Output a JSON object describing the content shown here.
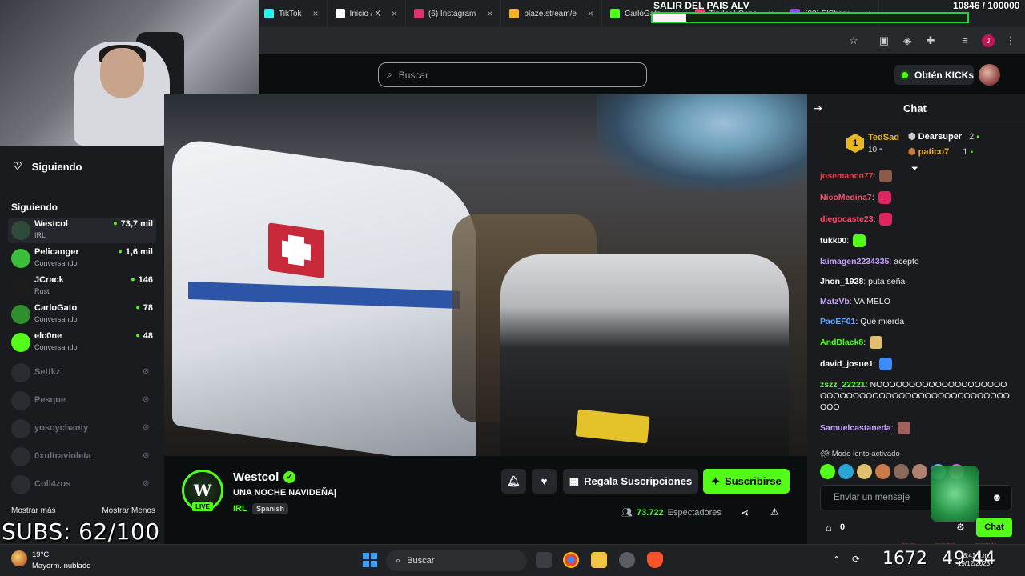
{
  "browser": {
    "tabs": [
      {
        "label": "TikTok",
        "color": "#25f4ee"
      },
      {
        "label": "Inicio / X",
        "color": "#ffffff"
      },
      {
        "label": "(6) Instagram",
        "color": "#e1306c"
      },
      {
        "label": "blaze.stream/e",
        "color": "#f0b429"
      },
      {
        "label": "CarloGato",
        "color": "#53fc18"
      },
      {
        "label": "Tinder | Conc",
        "color": "#fe3c72"
      },
      {
        "label": "(33) ElShark_",
        "color": "#9146ff"
      }
    ]
  },
  "stream_overlay": {
    "goal_label": "SALIR DEL PAIS ALV",
    "goal_count": "10846 / 100000",
    "goal_progress": 0.108,
    "subs_goal": "SUBS: 62/100"
  },
  "header": {
    "search_placeholder": "Buscar",
    "kicks_button": "Obtén KICKs"
  },
  "sidebar": {
    "title": "Siguiendo",
    "subtitle": "Siguiendo",
    "live_channels": [
      {
        "name": "Westcol",
        "category": "IRL",
        "viewers": "73,7 mil",
        "color": "#2e4a3a",
        "active": true
      },
      {
        "name": "Pelicanger",
        "category": "Conversando",
        "viewers": "1,6 mil",
        "color": "#3bbf3b",
        "active": false
      },
      {
        "name": "JCrack",
        "category": "Rust",
        "viewers": "146",
        "color": "#1c1c1c",
        "active": false
      },
      {
        "name": "CarloGato",
        "category": "Conversando",
        "viewers": "78",
        "color": "#2f8f2f",
        "active": false
      },
      {
        "name": "elc0ne",
        "category": "Conversando",
        "viewers": "48",
        "color": "#53fc18",
        "active": false
      }
    ],
    "offline_channels": [
      "Settkz",
      "Pesque",
      "yosoychanty",
      "0xultravioleta",
      "Coll4zos"
    ],
    "show_more": "Mostrar más",
    "show_less": "Mostrar Menos"
  },
  "stream_info": {
    "channel": "Westcol",
    "live_badge": "LIVE",
    "title": "UNA NOCHE NAVIDEÑA|",
    "category": "IRL",
    "language": "Spanish",
    "gift_subs_button": "Regala Suscripciones",
    "subscribe_button": "Suscribirse",
    "viewer_count": "73.722",
    "viewers_label": "Espectadores"
  },
  "chat": {
    "title": "Chat",
    "top_gifters": [
      {
        "name": "TedSad",
        "count": "10",
        "rank": "1",
        "color": "#e6b625"
      },
      {
        "name": "Dearsuper",
        "count": "2",
        "color": "#ffffff"
      },
      {
        "name": "patico7",
        "count": "1",
        "color": "#f0b429"
      }
    ],
    "messages": [
      {
        "user": "josemanco77",
        "text": "",
        "color": "#e04040",
        "emote": "#8a5a4a"
      },
      {
        "user": "NicoMedina7",
        "text": "",
        "color": "#ff4d6d",
        "emote": "#e0245e"
      },
      {
        "user": "diegocaste23",
        "text": "",
        "color": "#ff4d6d",
        "emote": "#e0245e"
      },
      {
        "user": "tukk00",
        "text": "",
        "color": "#ffffff",
        "emote": "#53fc18"
      },
      {
        "user": "laimagen2234335",
        "text": "acepto",
        "color": "#c8a2ff"
      },
      {
        "user": "Jhon_1928",
        "text": "puta señal",
        "color": "#ffffff"
      },
      {
        "user": "MatzVb",
        "text": "VA MELO",
        "color": "#c8a2ff"
      },
      {
        "user": "PaoEF01",
        "text": "Qué mierda",
        "color": "#5aa9ff"
      },
      {
        "user": "AndBlack8",
        "text": "",
        "color": "#53fc18",
        "emote": "#e0c070"
      },
      {
        "user": "david_josue1",
        "text": "",
        "color": "#ffffff",
        "emote": "#3a8cff"
      },
      {
        "user": "zszz_22221",
        "text": "NOOOOOOOOOOOOOOOOOOOOOOOOOOOOOOOOOOOOOOOOOOOOOOOOOOOO",
        "color": "#53fc18"
      },
      {
        "user": "Samuelcastaneda",
        "text": "",
        "color": "#c8a2ff",
        "emote": "#a06060"
      }
    ],
    "slow_mode": "Modo lento activado",
    "input_placeholder": "Enviar un mensaje",
    "coins": "0",
    "send_button": "Chat",
    "countdown_labels": [
      "hours",
      "minutes",
      "seconds"
    ]
  },
  "taskbar": {
    "weather_temp": "19°C",
    "weather_desc": "Mayorm. nublado",
    "search_placeholder": "Buscar",
    "tray_number": "1672",
    "tray_timer": "49 44",
    "clock_time": "8:41 p.m.",
    "clock_date": "19/12/2023"
  }
}
